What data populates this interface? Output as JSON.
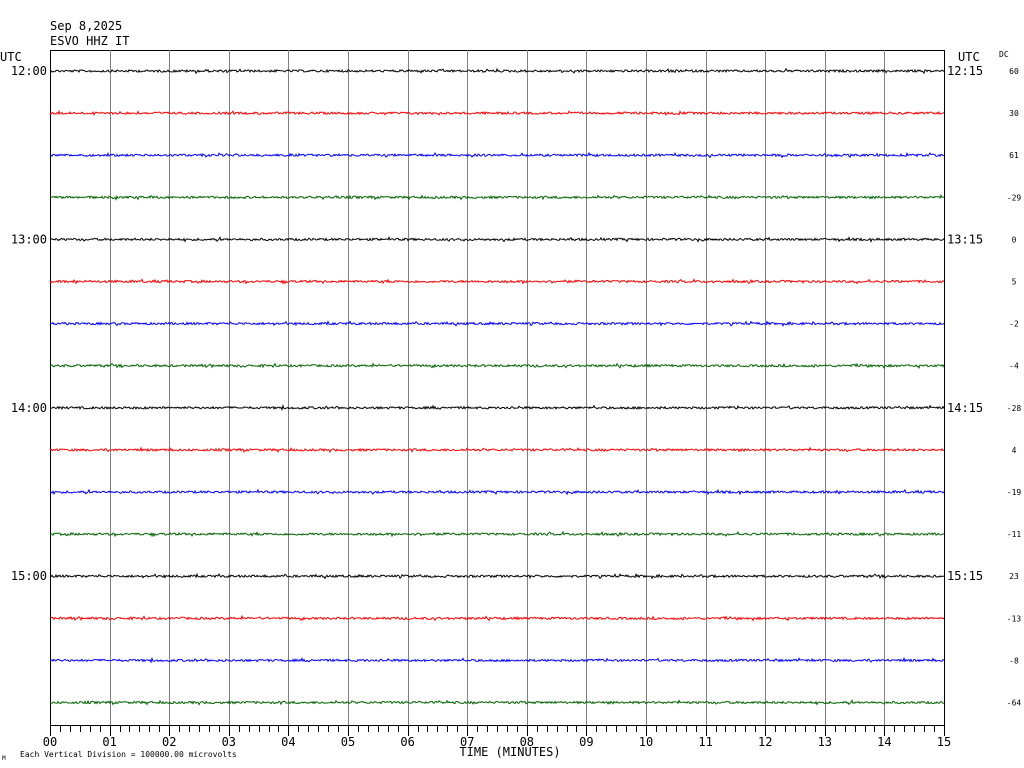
{
  "header": {
    "date": "Sep 8,2025",
    "station": "ESVO HHZ IT"
  },
  "left_axis_label": "UTC",
  "right_axis_label": "UTC",
  "dc_label": "DC",
  "footer": {
    "scale_note": "Each Vertical Division = 100000.00 microvolts",
    "corner_mark": "M"
  },
  "chart_data": {
    "type": "line",
    "title": "",
    "xlabel": "TIME (MINUTES)",
    "ylabel": "",
    "xlim": [
      0,
      15
    ],
    "x_tick_labels": [
      "00",
      "01",
      "02",
      "03",
      "04",
      "05",
      "06",
      "07",
      "08",
      "09",
      "10",
      "11",
      "12",
      "13",
      "14",
      "15"
    ],
    "trace_count": 16,
    "grid": true,
    "left_time_labels": [
      "12:00",
      "",
      "",
      "",
      "13:00",
      "",
      "",
      "",
      "14:00",
      "",
      "",
      "",
      "15:00",
      "",
      "",
      ""
    ],
    "right_time_labels": [
      "12:15",
      "",
      "",
      "",
      "13:15",
      "",
      "",
      "",
      "14:15",
      "",
      "",
      "",
      "15:15",
      "",
      "",
      ""
    ],
    "dc_offsets": [
      "60",
      "30",
      "61",
      "-29",
      "0",
      "5",
      "-2",
      "-4",
      "-28",
      "4",
      "-19",
      "-11",
      "23",
      "-13",
      "-8",
      "-64"
    ],
    "trace_colors": [
      "#000000",
      "#ff0000",
      "#0000ff",
      "#006400"
    ],
    "units": "microvolts",
    "vertical_division": "100000.00"
  }
}
